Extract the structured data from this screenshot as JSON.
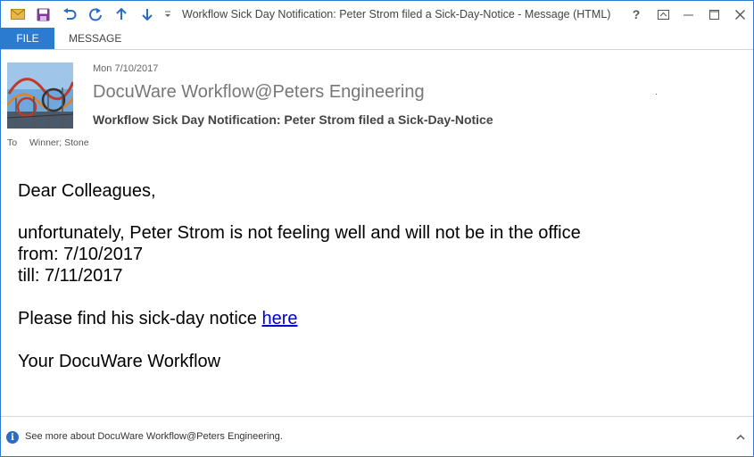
{
  "window": {
    "title": "Workflow Sick Day Notification: Peter Strom filed a Sick-Day-Notice - Message (HTML)"
  },
  "ribbon": {
    "tabs": [
      "FILE",
      "MESSAGE"
    ]
  },
  "message": {
    "date": "Mon 7/10/2017",
    "sender": "DocuWare Workflow@Peters Engineering",
    "subject": "Workflow Sick Day Notification: Peter Strom filed a Sick-Day-Notice",
    "to_label": "To",
    "to_value": "Winner; Stone"
  },
  "body": {
    "greeting": "Dear Colleagues,",
    "line1": "unfortunately, Peter Strom is not feeling well and will not be in the office",
    "line2": "from: 7/10/2017",
    "line3": "till: 7/11/2017",
    "link_prefix": "Please find his sick-day notice ",
    "link_text": "here",
    "signature": "Your DocuWare Workflow"
  },
  "footer": {
    "text": "See more about DocuWare Workflow@Peters Engineering."
  },
  "colors": {
    "accent": "#2b7bd1",
    "link": "#0000cc"
  }
}
